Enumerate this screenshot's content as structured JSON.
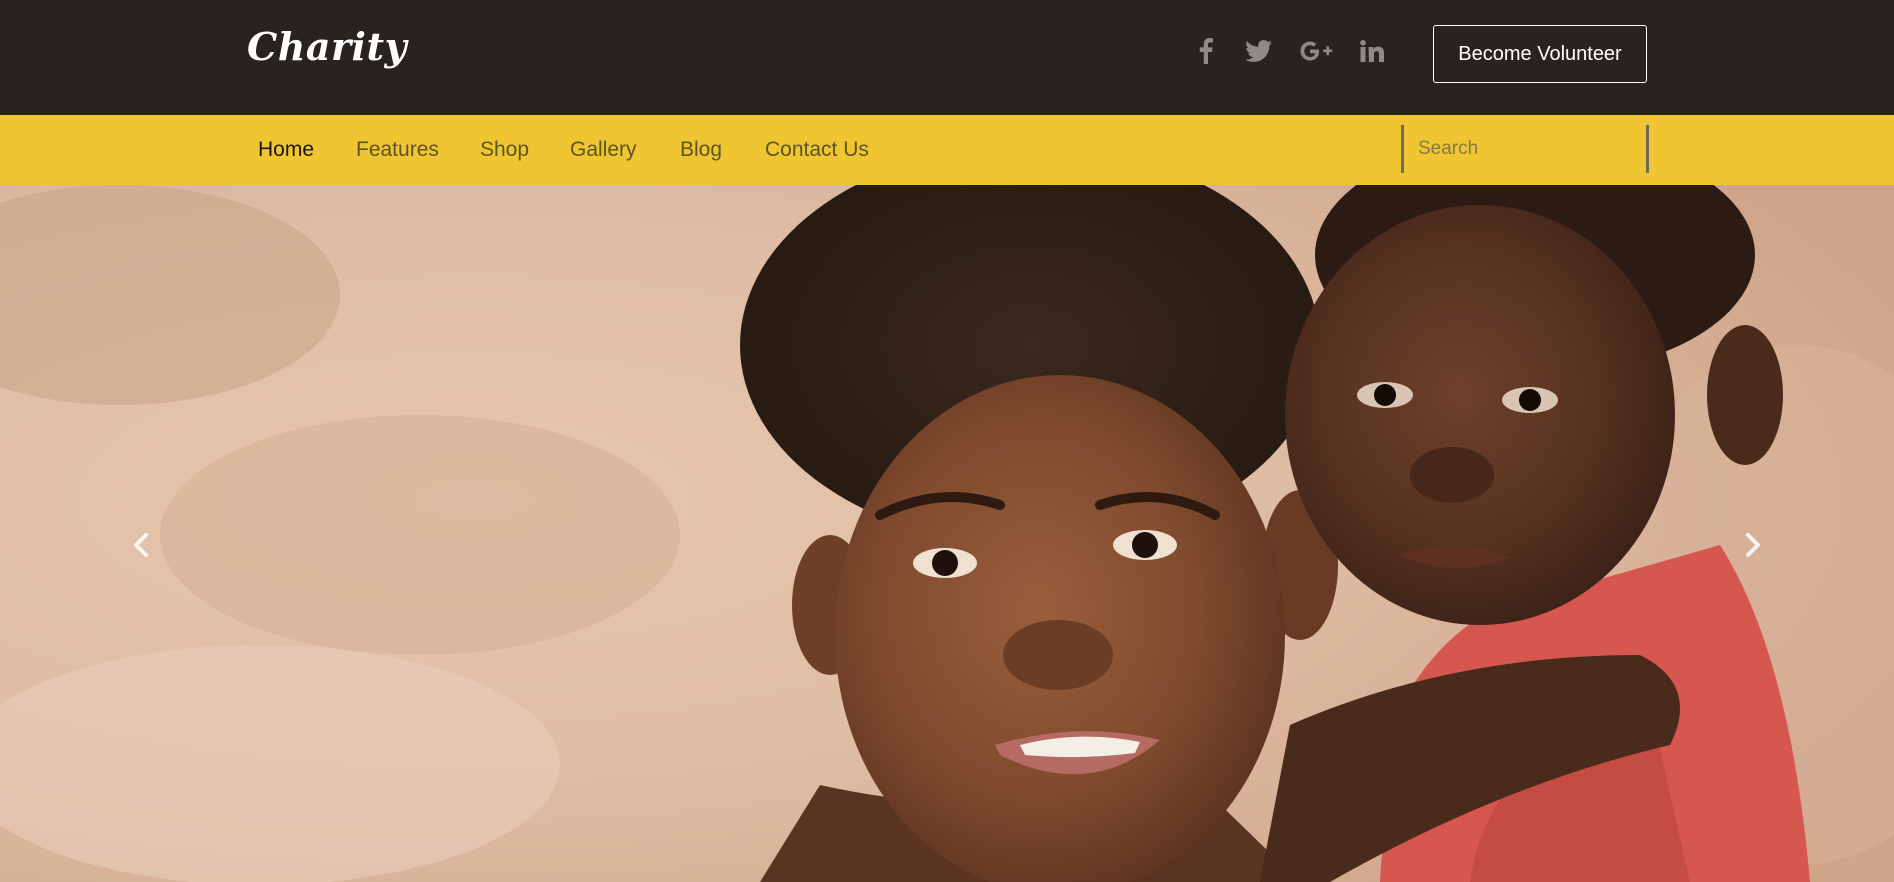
{
  "header": {
    "logo": "Charity",
    "social_icons": [
      "facebook-icon",
      "twitter-icon",
      "google-plus-icon",
      "linkedin-icon"
    ],
    "volunteer_button": "Become Volunteer"
  },
  "nav": {
    "items": [
      {
        "label": "Home",
        "active": true
      },
      {
        "label": "Features",
        "active": false
      },
      {
        "label": "Shop",
        "active": false
      },
      {
        "label": "Gallery",
        "active": false
      },
      {
        "label": "Blog",
        "active": false
      },
      {
        "label": "Contact Us",
        "active": false
      }
    ],
    "search": {
      "placeholder": "Search",
      "value": ""
    }
  },
  "hero": {
    "image": "two-children-photo",
    "controls": [
      "chevron-left-icon",
      "chevron-right-icon"
    ]
  },
  "colors": {
    "header_bg": "#28231f",
    "nav_bg": "#efc632",
    "social_icon": "#8d8a87",
    "nav_text": "#5e5325",
    "nav_active": "#1a1712"
  }
}
